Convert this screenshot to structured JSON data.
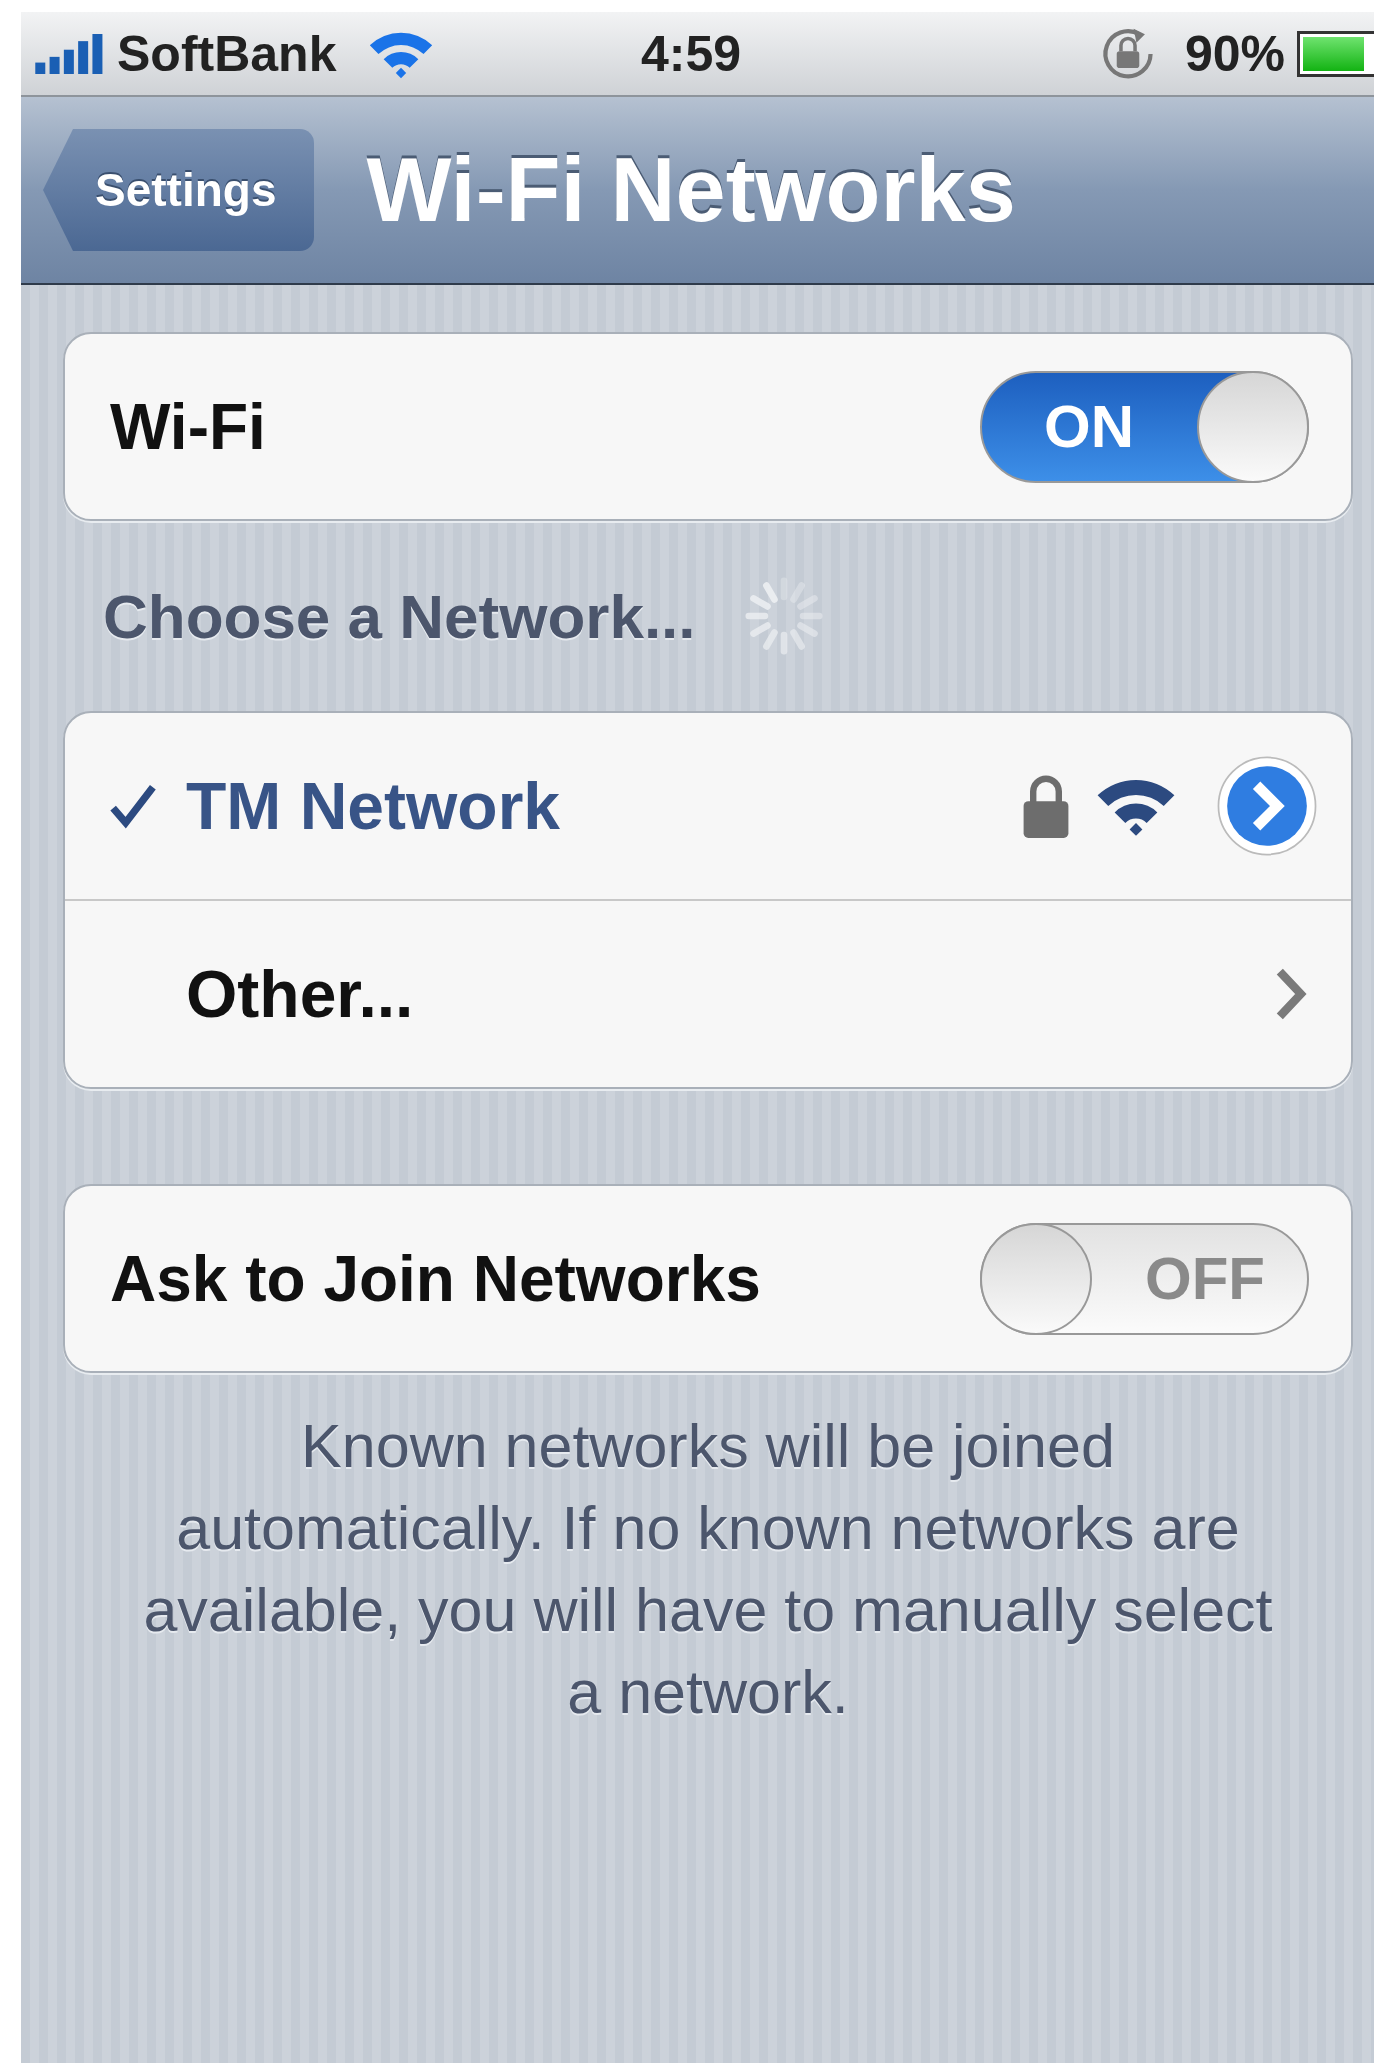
{
  "status_bar": {
    "carrier": "SoftBank",
    "time": "4:59",
    "battery_text": "90%",
    "battery": {
      "level": 0.9
    }
  },
  "nav_bar": {
    "back": "Settings",
    "title": "Wi-Fi Networks"
  },
  "wifi": {
    "label": "Wi-Fi",
    "on": true,
    "switch_text": "ON"
  },
  "section_header": {
    "title": "Choose a Network...",
    "loading": true
  },
  "networks": [
    {
      "kind": "network",
      "name": "TM Network",
      "selected": true,
      "locked": true
    },
    {
      "kind": "other",
      "name": "Other..."
    }
  ],
  "ask_to_join": {
    "label": "Ask to Join Networks",
    "on": false,
    "switch_text": "OFF"
  },
  "footer": "Known networks will be joined automatically. If no known networks are available, you will have to manually select a network."
}
